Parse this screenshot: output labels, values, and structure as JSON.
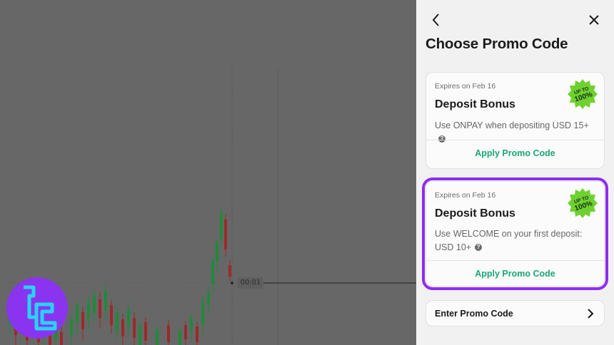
{
  "chart": {
    "time_label": "00:01"
  },
  "logo": {
    "icon": "tradingfinder-logo-icon"
  },
  "panel": {
    "title": "Choose Promo Code",
    "back_icon": "chevron-left-icon",
    "close_icon": "close-icon"
  },
  "promos": [
    {
      "expires": "Expires on Feb 16",
      "title": "Deposit Bonus",
      "description": "Use ONPAY when depositing USD 15+",
      "badge": "UP TO 100%",
      "apply_label": "Apply Promo Code",
      "selected": false
    },
    {
      "expires": "Expires on Feb 16",
      "title": "Deposit Bonus",
      "description": "Use WELCOME on your first deposit: USD 10+",
      "badge": "UP TO 100%",
      "apply_label": "Apply Promo Code",
      "selected": true
    }
  ],
  "enter_code": {
    "label": "Enter Promo Code",
    "icon": "chevron-right-icon"
  },
  "colors": {
    "accent_green": "#1ba773",
    "highlight_purple": "#8e2ef0",
    "badge_green": "#6fd12f",
    "candle_up": "#1f8a3a",
    "candle_down": "#9b2a2a"
  }
}
